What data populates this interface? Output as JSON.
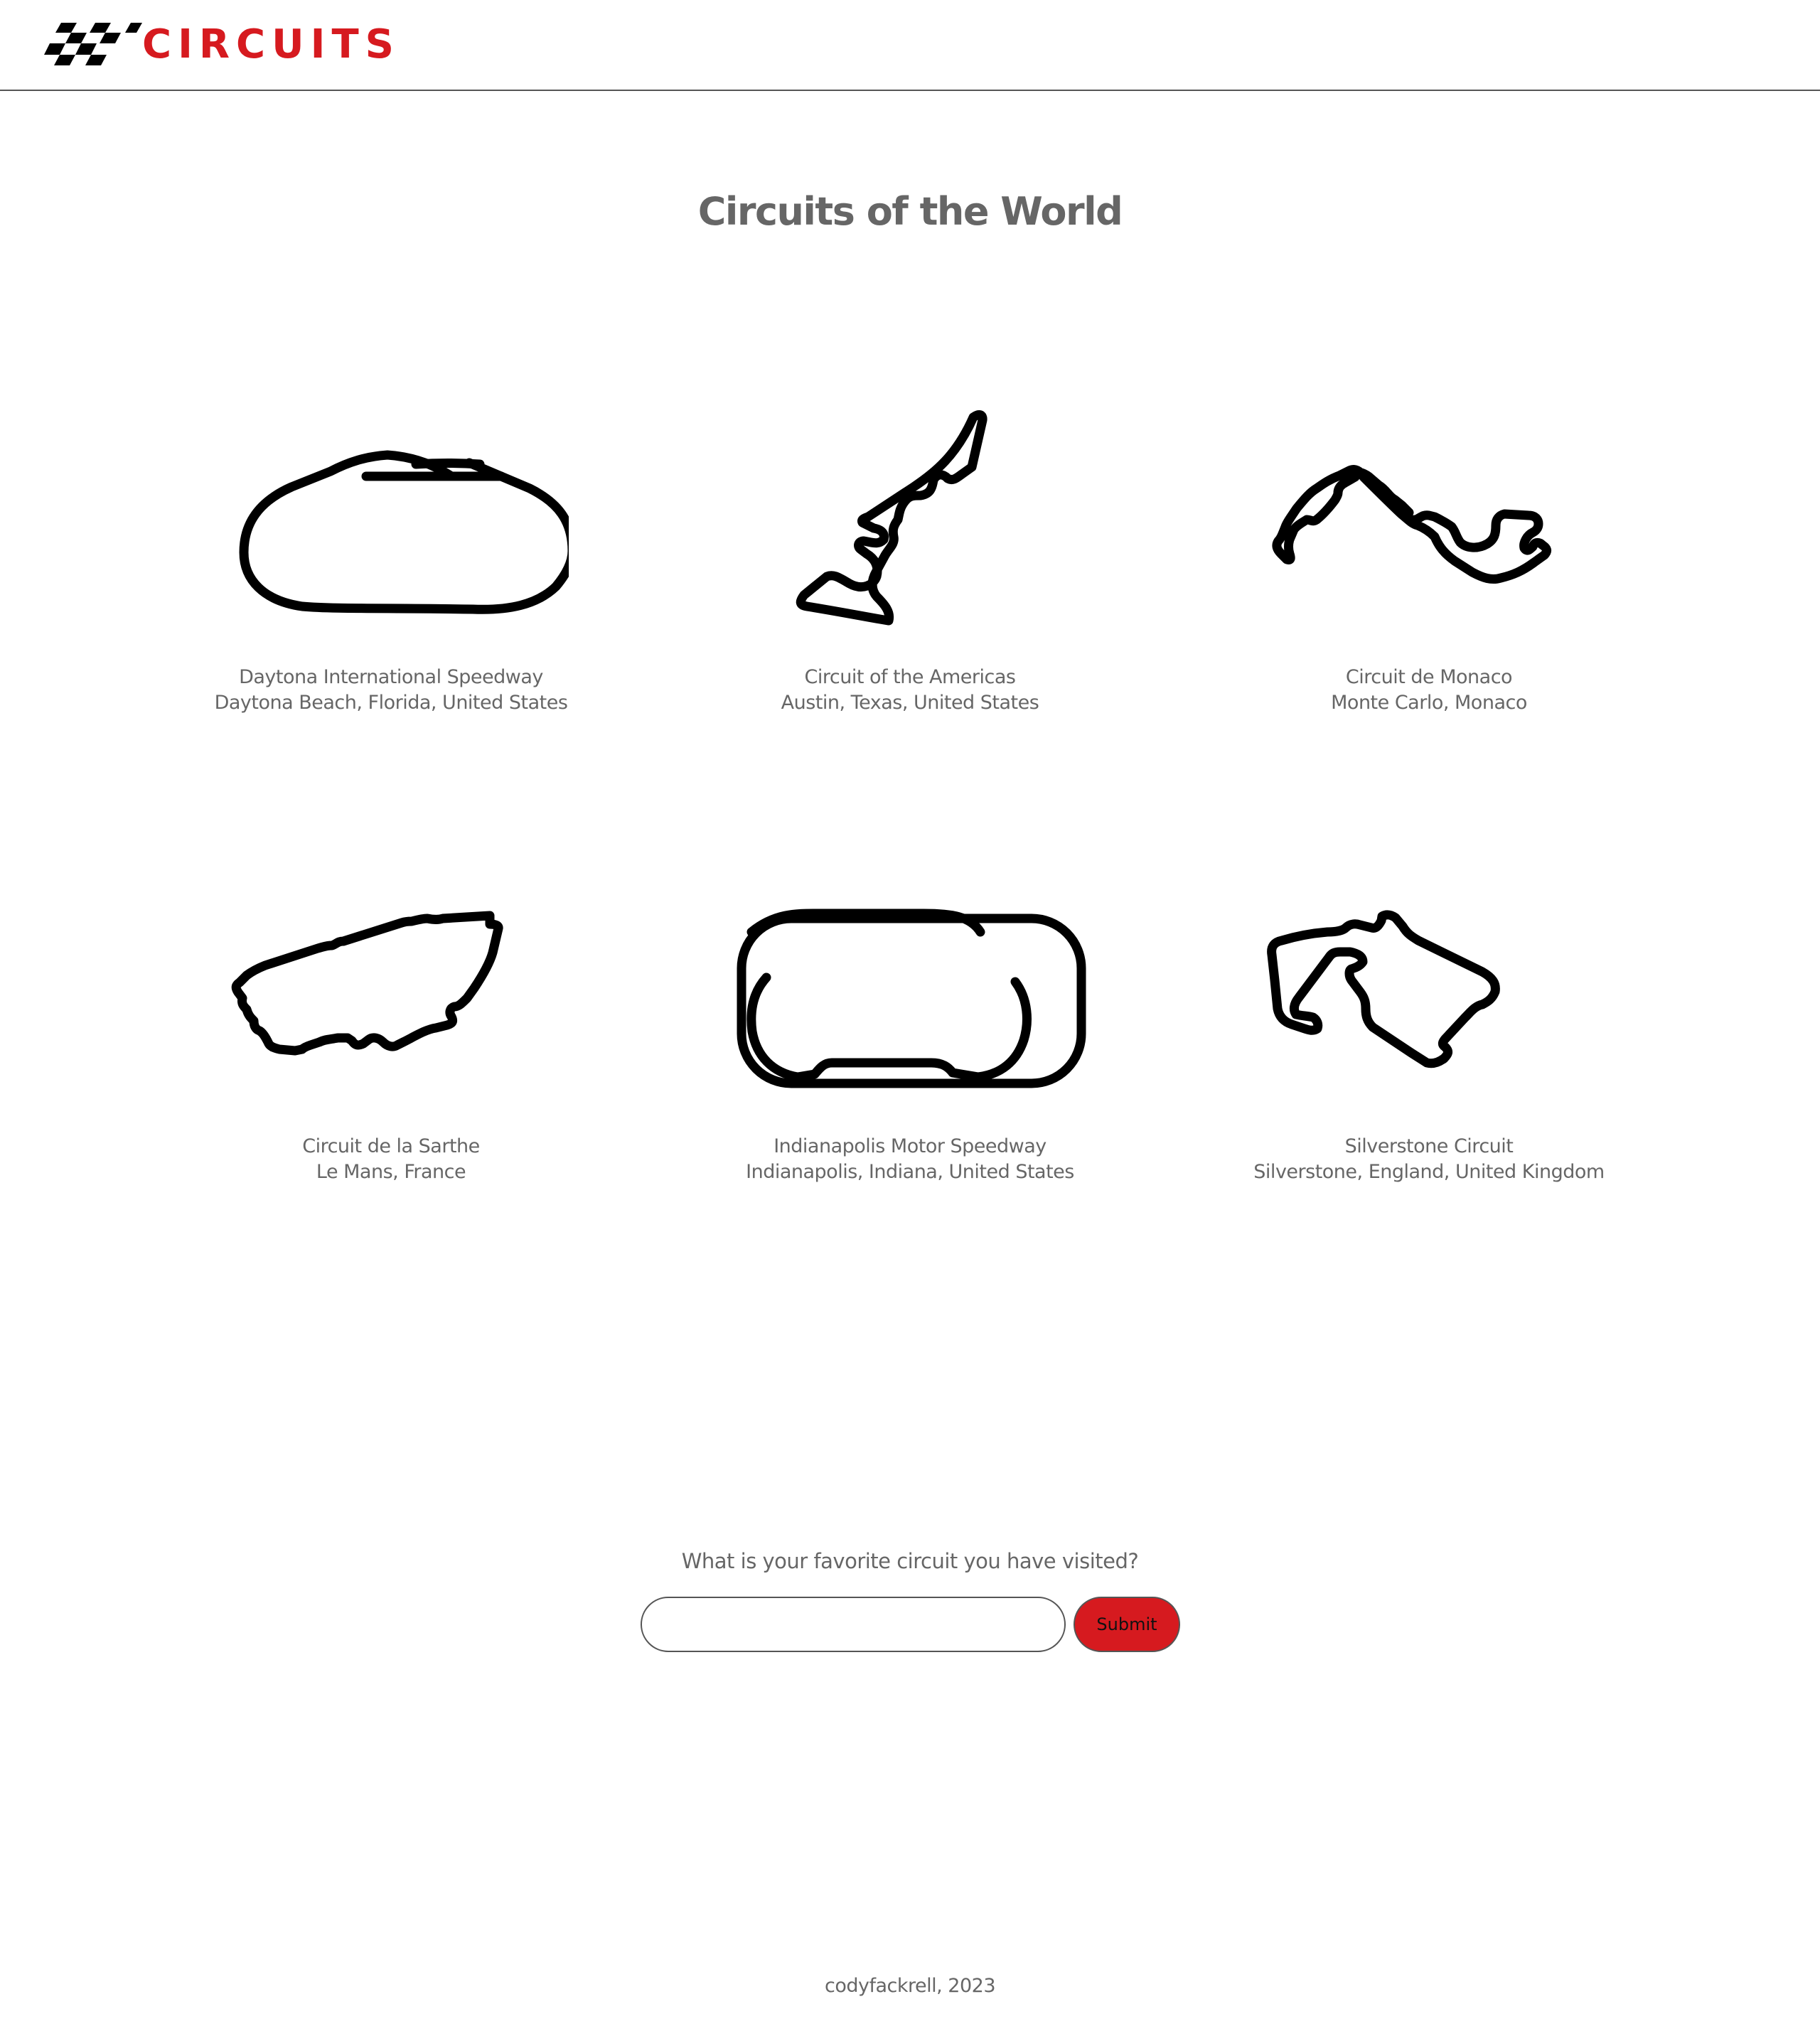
{
  "header": {
    "logo_text": "CIRCUITS",
    "brand_color": "#d61a1f"
  },
  "page": {
    "title": "Circuits of the World"
  },
  "circuits": [
    {
      "name": "Daytona International Speedway",
      "location": "Daytona Beach, Florida, United States",
      "icon": "daytona-track-icon"
    },
    {
      "name": "Circuit of the Americas",
      "location": "Austin, Texas, United States",
      "icon": "cota-track-icon"
    },
    {
      "name": "Circuit de Monaco",
      "location": "Monte Carlo, Monaco",
      "icon": "monaco-track-icon"
    },
    {
      "name": "Circuit de la Sarthe",
      "location": "Le Mans, France",
      "icon": "le-mans-track-icon"
    },
    {
      "name": "Indianapolis Motor Speedway",
      "location": "Indianapolis, Indiana, United States",
      "icon": "indianapolis-track-icon"
    },
    {
      "name": "Silverstone Circuit",
      "location": "Silverstone, England, United Kingdom",
      "icon": "silverstone-track-icon"
    }
  ],
  "form": {
    "question": "What is your favorite circuit you have visited?",
    "input_value": "",
    "submit_label": "Submit"
  },
  "footer": {
    "text": "codyfackrell, 2023"
  }
}
